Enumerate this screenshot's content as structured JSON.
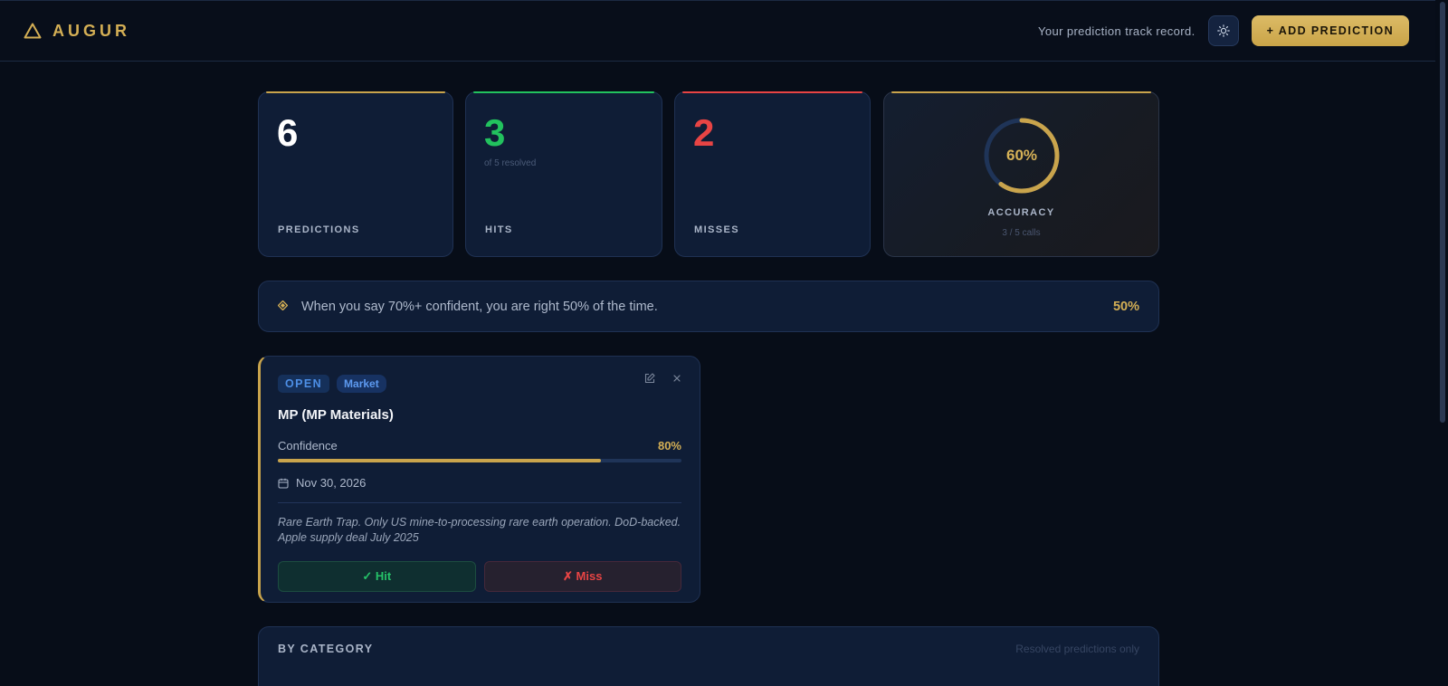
{
  "header": {
    "brand": "AUGUR",
    "tagline": "Your prediction track record.",
    "add_button": "+ ADD PREDICTION",
    "theme_icon": "sun-icon",
    "logo_icon": "triangle-icon"
  },
  "stats": {
    "predictions": {
      "value": "6",
      "label": "PREDICTIONS",
      "color": "#ffffff",
      "accent": "#c9a44c"
    },
    "hits": {
      "value": "3",
      "sub": "of 5 resolved",
      "label": "HITS",
      "color": "#22c25e",
      "accent": "#22c25e"
    },
    "misses": {
      "value": "2",
      "label": "MISSES",
      "color": "#e84444",
      "accent": "#e84444"
    },
    "accuracy": {
      "value": "60%",
      "fraction": 0.6,
      "label": "ACCURACY",
      "sub": "3 / 5 calls",
      "color": "#d4af55"
    }
  },
  "insight": {
    "text": "When you say 70%+ confident, you are right 50% of the time.",
    "value": "50%",
    "icon": "diamond-icon"
  },
  "prediction": {
    "status": "OPEN",
    "category": "Market",
    "title": "MP (MP Materials)",
    "confidence_label": "Confidence",
    "confidence": "80%",
    "confidence_fraction": 0.8,
    "date": "Nov 30, 2026",
    "notes": "Rare Earth Trap. Only US mine-to-processing rare earth operation. DoD-backed. Apple supply deal July 2025",
    "hit_label": "✓ Hit",
    "miss_label": "✗ Miss"
  },
  "by_category": {
    "title": "BY CATEGORY",
    "note": "Resolved predictions only"
  }
}
